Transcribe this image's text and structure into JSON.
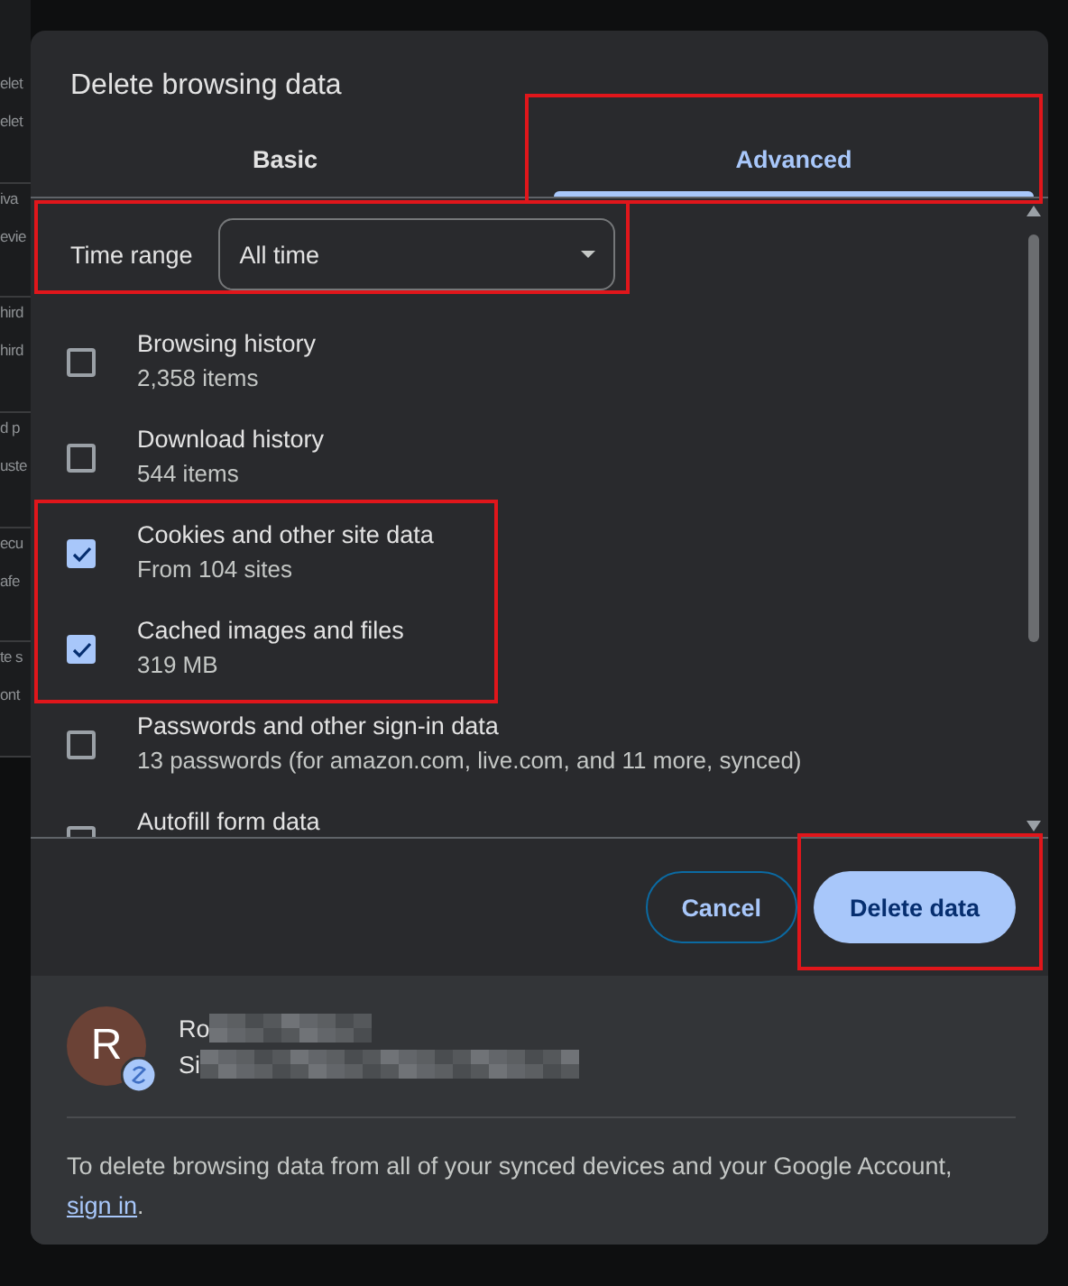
{
  "background_fragments": [
    [
      "elet",
      "elet"
    ],
    [
      "iva",
      "evie"
    ],
    [
      "hird",
      "hird"
    ],
    [
      "d p",
      "uste"
    ],
    [
      "ecu",
      "afe"
    ],
    [
      "te s",
      "ont"
    ]
  ],
  "dialog": {
    "title": "Delete browsing data",
    "tabs": [
      {
        "label": "Basic",
        "selected": false,
        "highlighted": false
      },
      {
        "label": "Advanced",
        "selected": true,
        "highlighted": true
      }
    ],
    "time_range": {
      "label": "Time range",
      "value": "All time",
      "highlighted": true
    },
    "options": [
      {
        "label": "Browsing history",
        "detail": "2,358 items",
        "checked": false,
        "highlighted": false
      },
      {
        "label": "Download history",
        "detail": "544 items",
        "checked": false,
        "highlighted": false
      },
      {
        "label": "Cookies and other site data",
        "detail": "From 104 sites",
        "checked": true,
        "highlighted": true
      },
      {
        "label": "Cached images and files",
        "detail": "319 MB",
        "checked": true,
        "highlighted": true
      },
      {
        "label": "Passwords and other sign-in data",
        "detail": "13 passwords (for amazon.com, live.com, and 11 more, synced)",
        "checked": false,
        "highlighted": false
      },
      {
        "label": "Autofill form data",
        "checked": false,
        "highlighted": false
      }
    ],
    "buttons": [
      {
        "label": "Cancel",
        "kind": "outline",
        "highlighted": false
      },
      {
        "label": "Delete data",
        "kind": "filled",
        "highlighted": true
      }
    ],
    "account": {
      "initial": "R",
      "name": "Ro",
      "email": "Si"
    },
    "sync_note": {
      "before": "To delete browsing data from all of your synced devices and your Google Account, ",
      "link": "sign in",
      "after": "."
    }
  }
}
